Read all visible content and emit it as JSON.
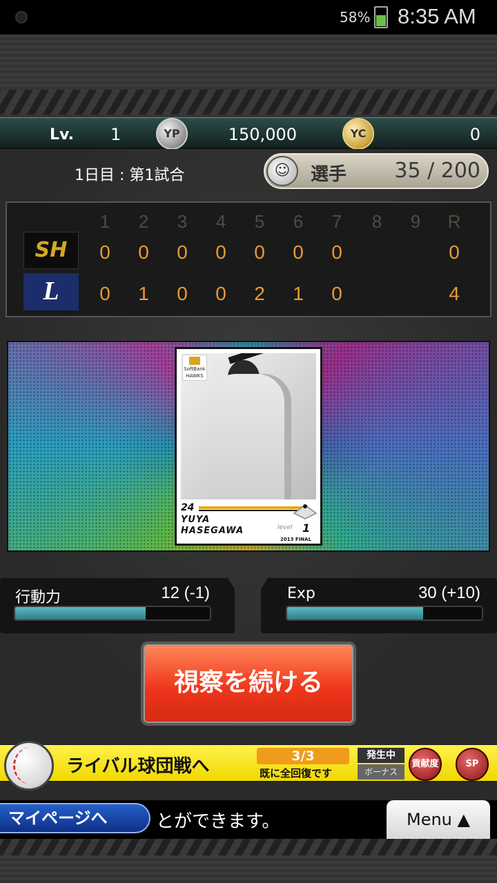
{
  "status_bar": {
    "battery": "58%",
    "time": "8:35 AM"
  },
  "info": {
    "lv_label": "Lv.",
    "lv_value": "1",
    "yp_label": "YP",
    "yp_value": "150,000",
    "yc_label": "YC",
    "yc_value": "0"
  },
  "game": {
    "day_text": "1日目 : 第1試合",
    "player_label": "選手",
    "player_count": "35 / 200"
  },
  "scoreboard": {
    "innings": [
      "1",
      "2",
      "3",
      "4",
      "5",
      "6",
      "7",
      "8",
      "9",
      "R"
    ],
    "teams": [
      {
        "logo": "SH",
        "scores": [
          "0",
          "0",
          "0",
          "0",
          "0",
          "0",
          "0",
          "",
          "",
          "0"
        ]
      },
      {
        "logo": "L",
        "scores": [
          "0",
          "1",
          "0",
          "0",
          "2",
          "1",
          "0",
          "",
          "",
          "4"
        ]
      }
    ]
  },
  "card": {
    "team_text": "SoftBank HAWKS",
    "number": "24",
    "name_first": "YUYA",
    "name_last": "HASEGAWA",
    "level_label": "level",
    "level_value": "1",
    "footer": "2013 FINAL"
  },
  "stats": {
    "action": {
      "label": "行動力",
      "value": "12 (-1)",
      "fill": 0.67
    },
    "exp": {
      "label": "Exp",
      "value": "30 (+10)",
      "fill": 0.7
    }
  },
  "cta_label": "視察を続ける",
  "banner": {
    "title": "ライバル球団戦へ",
    "count": "3/3",
    "count_sub": "既に全回復です",
    "status_label": "発生中",
    "bonus_label": "ボーナス",
    "badge1": "貢献度",
    "badge2": "SP"
  },
  "nav": {
    "mypage_label": "マイページへ",
    "ticker": "とができます。",
    "menu_label": "Menu ▲"
  },
  "colors": {
    "score": "#e99a35",
    "cta": "#f0361c",
    "bar": "#3f9aa6",
    "banner": "#fff14a"
  }
}
